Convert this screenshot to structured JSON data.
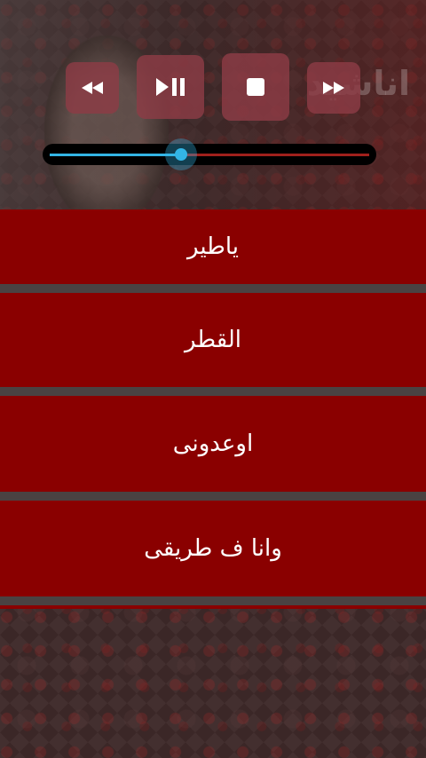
{
  "header": {
    "watermark_title": "اناشيد"
  },
  "player": {
    "controls": [
      {
        "name": "rewind-button",
        "icon": "rewind-icon"
      },
      {
        "name": "play-pause-button",
        "icon": "play-pause-icon"
      },
      {
        "name": "stop-button",
        "icon": "stop-icon"
      },
      {
        "name": "fast-forward-button",
        "icon": "fast-forward-icon"
      }
    ],
    "progress": 0.41,
    "colors": {
      "accent": "#33b5e5",
      "track": "#a0201c",
      "button": "#8c3c46"
    }
  },
  "tracks": [
    {
      "label": "ياطير"
    },
    {
      "label": "القطر"
    },
    {
      "label": "اوعدونى"
    },
    {
      "label": "وانا ف طريقى"
    }
  ],
  "colors": {
    "list_item": "#8a0000",
    "divider": "#4a4242"
  }
}
